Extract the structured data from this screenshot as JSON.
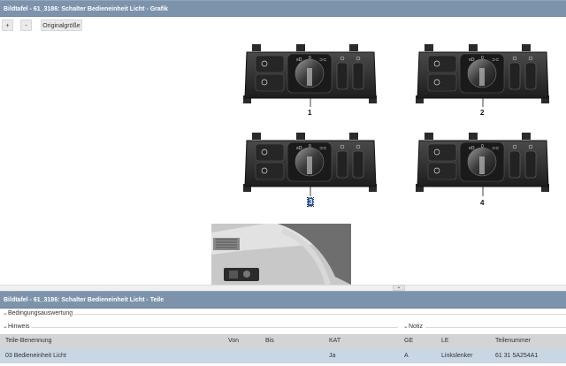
{
  "top_panel": {
    "title": "Bildtafel - 61_3186: Schalter Bedieneinheit Licht - Grafik"
  },
  "toolbar": {
    "zoom_in": "+",
    "zoom_out": "-",
    "original_size": "Originalgröße"
  },
  "graphic": {
    "panels": [
      {
        "number": "1",
        "selected": false
      },
      {
        "number": "2",
        "selected": false
      },
      {
        "number": "3",
        "selected": true
      },
      {
        "number": "4",
        "selected": false
      }
    ],
    "scroll_arrow": "⌄"
  },
  "bottom_panel": {
    "title": "Bildtafel - 61_3186: Schalter Bedieneinheit Licht - Teile"
  },
  "sections": {
    "condition": "Bedingungsauswertung",
    "hint": "Hinweis",
    "note": "Notiz"
  },
  "table": {
    "headers": [
      "Teile-Benennung",
      "Von",
      "Bis",
      "KAT",
      "GE",
      "LE",
      "Teilenummer"
    ],
    "rows": [
      [
        "03 Bedieneinheit Licht",
        "",
        "",
        "Ja",
        "A",
        "Linkslenker",
        "61 31 5A254A1"
      ]
    ]
  },
  "colors": {
    "titlebar": "#7c93ab",
    "selected_row": "#c9d6e4",
    "header_row": "#d4d4d4",
    "selected_number": "#1f4fa8"
  }
}
